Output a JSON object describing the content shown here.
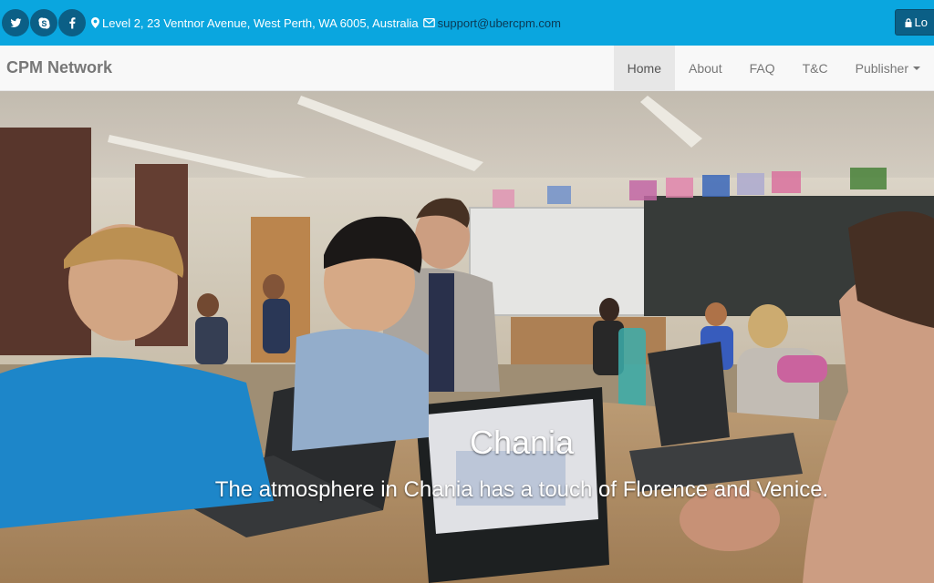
{
  "topbar": {
    "social": [
      {
        "name": "twitter-icon"
      },
      {
        "name": "skype-icon"
      },
      {
        "name": "facebook-icon"
      }
    ],
    "address": "Level 2, 23 Ventnor Avenue, West Perth, WA 6005, Australia",
    "email": "support@ubercpm.com",
    "login_label": "Lo"
  },
  "navbar": {
    "brand": "CPM Network",
    "items": [
      {
        "label": "Home",
        "active": true
      },
      {
        "label": "About"
      },
      {
        "label": "FAQ"
      },
      {
        "label": "T&C"
      },
      {
        "label": "Publisher",
        "dropdown": true
      }
    ]
  },
  "carousel": {
    "title": "Chania",
    "text": "The atmosphere in Chania has a touch of Florence and Venice."
  },
  "colors": {
    "topbar_bg": "#0aa6df",
    "social_bg": "#0b5f86",
    "navbar_bg": "#f8f8f8",
    "active_bg": "#e7e7e7"
  }
}
